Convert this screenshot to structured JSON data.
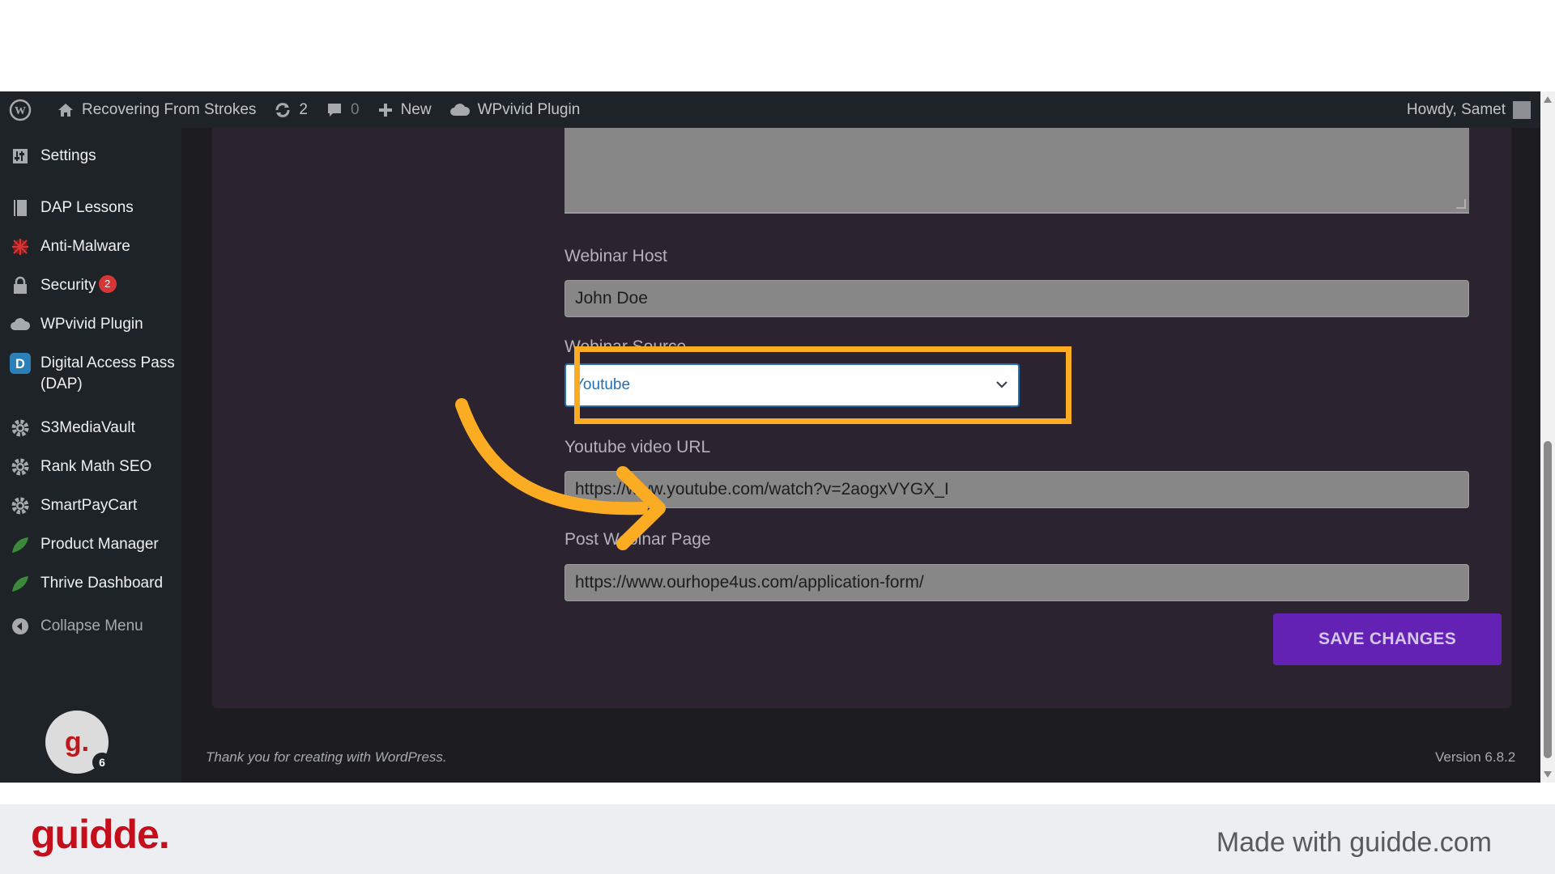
{
  "admin_bar": {
    "site_name": "Recovering From Strokes",
    "updates_count": "2",
    "comments_count": "0",
    "new_label": "New",
    "plugin_label": "WPvivid Plugin",
    "howdy": "Howdy, Samet"
  },
  "sidebar": {
    "items": [
      {
        "label": "Settings",
        "icon": "settings-icon"
      },
      {
        "label": "DAP Lessons",
        "icon": "book-icon"
      },
      {
        "label": "Anti-Malware",
        "icon": "shield-bug-icon"
      },
      {
        "label": "Security",
        "icon": "lock-icon",
        "badge": "2"
      },
      {
        "label": "WPvivid Plugin",
        "icon": "cloud-icon"
      },
      {
        "label": "Digital Access Pass",
        "label2": "(DAP)",
        "icon": "dap-icon"
      },
      {
        "label": "S3MediaVault",
        "icon": "gear-icon"
      },
      {
        "label": "Rank Math SEO",
        "icon": "gear-icon"
      },
      {
        "label": "SmartPayCart",
        "icon": "gear-icon"
      },
      {
        "label": "Product Manager",
        "icon": "leaf-icon"
      },
      {
        "label": "Thrive Dashboard",
        "icon": "leaf-icon"
      }
    ],
    "collapse_label": "Collapse Menu",
    "grammarly_count": "6"
  },
  "form": {
    "webinar_host_label": "Webinar Host",
    "webinar_host_value": "John Doe",
    "webinar_source_label": "Webinar Source",
    "webinar_source_value": "Youtube",
    "youtube_url_label": "Youtube video URL",
    "youtube_url_value": "https://www.youtube.com/watch?v=2aogxVYGX_I",
    "post_webinar_label": "Post Webinar Page",
    "post_webinar_value": "https://www.ourhope4us.com/application-form/",
    "save_label": "SAVE CHANGES"
  },
  "footer": {
    "thanks": "Thank you for creating with WordPress.",
    "version": "Version 6.8.2"
  },
  "guidde": {
    "logo": "guidde.",
    "made_with": "Made with guidde.com"
  },
  "colors": {
    "highlight": "#fbac22",
    "save_button": "#6422b4",
    "guidde_red": "#c40e1b"
  }
}
